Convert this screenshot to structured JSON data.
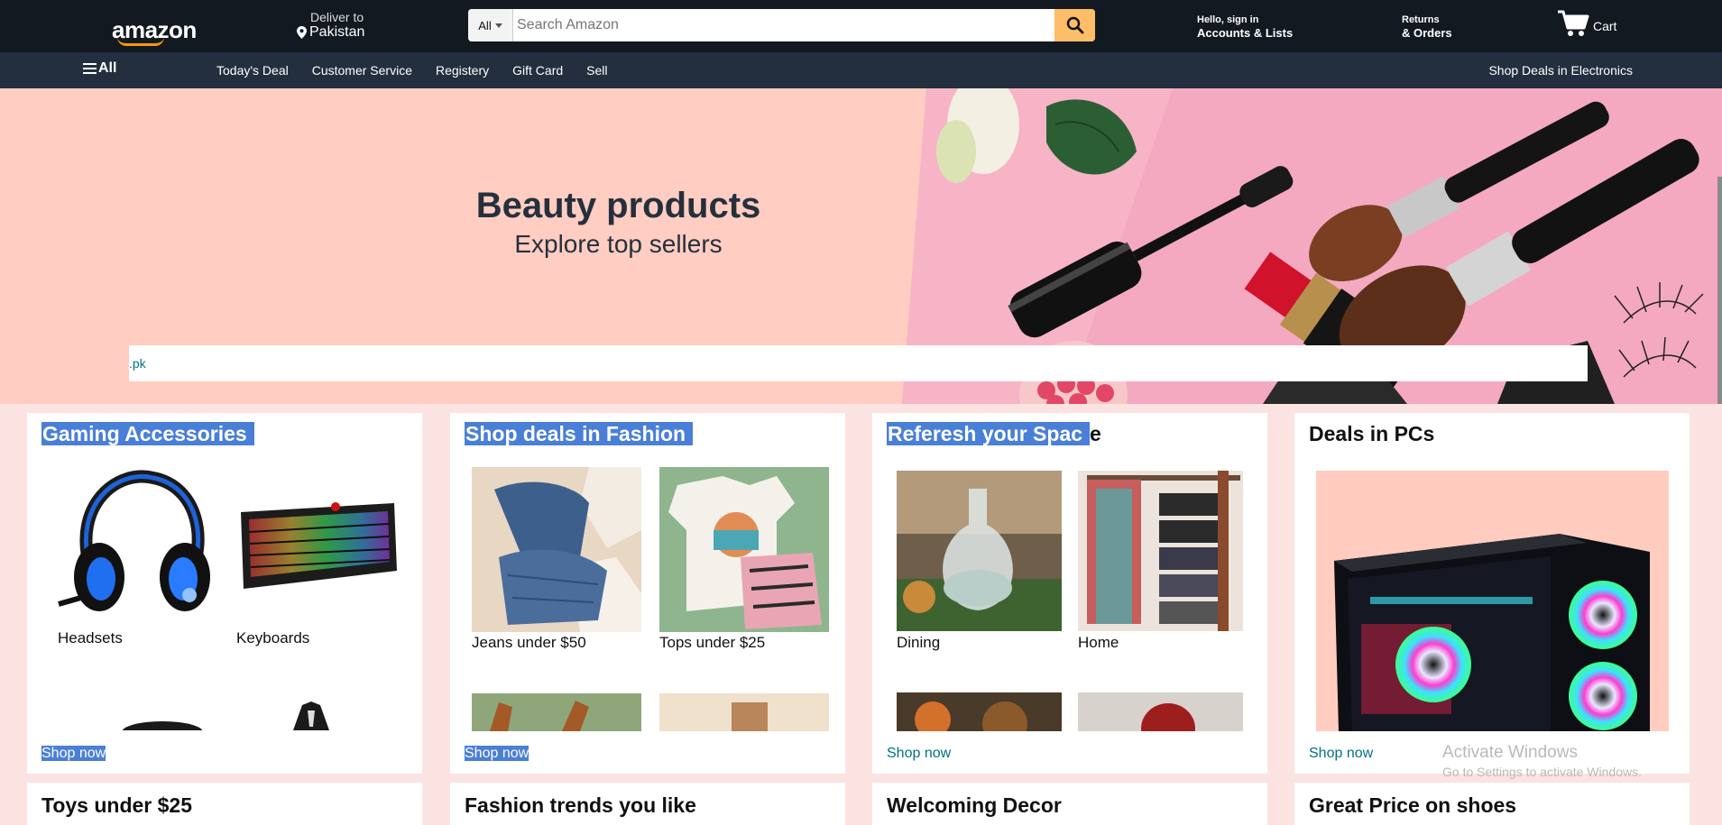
{
  "header": {
    "logo": "amazon",
    "deliver_line1": "Deliver to",
    "deliver_line2": "Pakistan",
    "search_category": "All",
    "search_placeholder": "Search Amazon",
    "account_line1": "Hello, sign in",
    "account_line2": "Accounts & Lists",
    "returns_line1": "Returns",
    "returns_line2": "& Orders",
    "cart_label": "Cart"
  },
  "nav": {
    "all_label": "All",
    "links": [
      "Today's Deal",
      "Customer Service",
      "Registery",
      "Gift Card",
      "Sell"
    ],
    "promo": "Shop Deals in Electronics"
  },
  "hero": {
    "title": "Beauty products",
    "subtitle": "Explore top sellers",
    "bar_text": ".pk"
  },
  "cards": [
    {
      "title": "Gaming Accessories",
      "items": [
        "Headsets",
        "Keyboards"
      ],
      "link": "Shop now"
    },
    {
      "title": "Shop deals in Fashion",
      "items": [
        "Jeans under $50",
        "Tops under $25"
      ],
      "link": "Shop now"
    },
    {
      "title_selected": "Referesh your Spac",
      "title_rest": "e",
      "items": [
        "Dining",
        "Home"
      ],
      "link": "Shop now"
    },
    {
      "title": "Deals in PCs",
      "link": "Shop now"
    }
  ],
  "row2": [
    "Toys under $25",
    "Fashion trends you like",
    "Welcoming Decor",
    "Great Price on shoes"
  ],
  "watermark": {
    "line1": "Activate Windows",
    "line2": "Go to Settings to activate Windows."
  },
  "colors": {
    "topbar": "#131921",
    "navbar": "#232f3e",
    "search_button": "#febd69",
    "link": "#007185",
    "selection": "#4a7fd8",
    "hero_bg": "#ffcdc2",
    "page_bg": "#fbe3e2"
  }
}
